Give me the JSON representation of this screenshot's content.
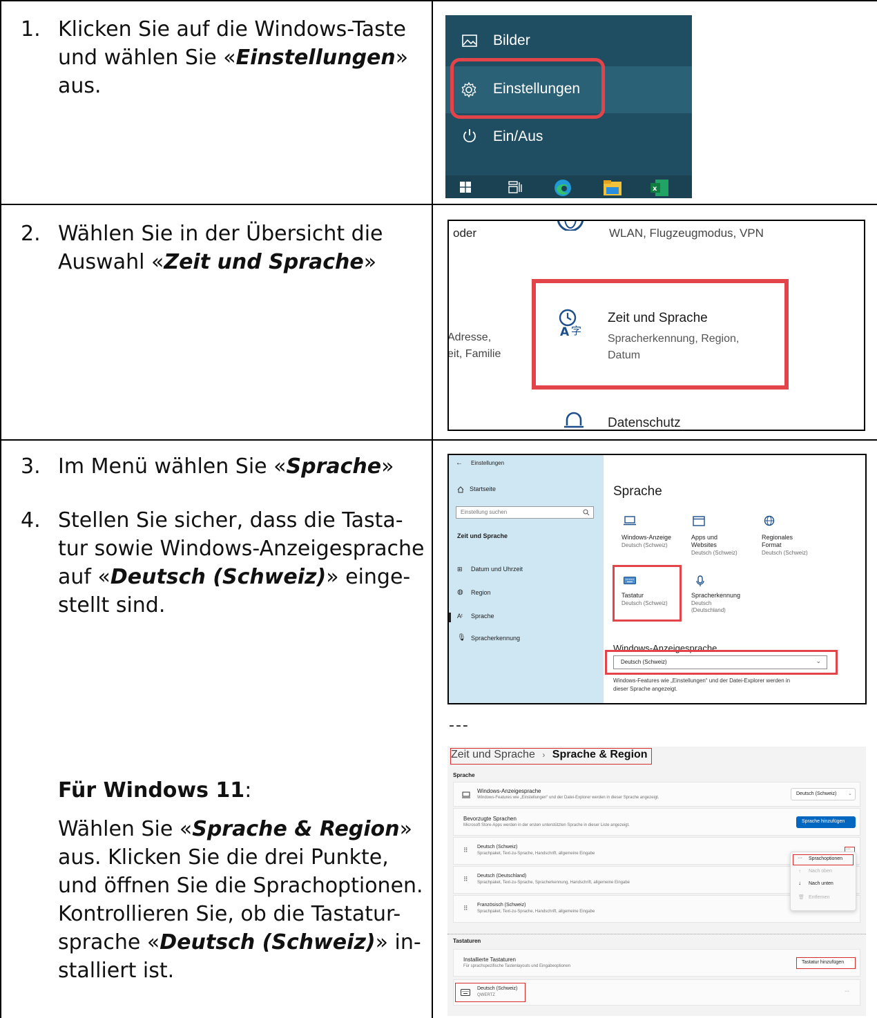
{
  "steps": {
    "s1": {
      "num": "1.",
      "l1": "Klicken Sie auf die Windows-Taste",
      "l2a": "und wählen Sie «",
      "l2b": "Einstellungen",
      "l2c": "»",
      "l3": "aus."
    },
    "s2": {
      "num": "2.",
      "l1": "Wählen Sie in der Übersicht die",
      "l2a": "Auswahl «",
      "l2b": "Zeit und Sprache",
      "l2c": "»"
    },
    "s3": {
      "num": "3.",
      "a": "Im Menü wählen Sie «",
      "b": "Sprache",
      "c": "»"
    },
    "s4": {
      "num": "4.",
      "l1": "Stellen Sie sicher, dass die Tasta-",
      "l2": "tur sowie Windows-Anzeigesprache",
      "l3a": "auf «",
      "l3b": "Deutsch (Schweiz)",
      "l3c": "» einge-",
      "l4": "stellt sind."
    },
    "w11": {
      "headA": "Für Windows 11",
      "headB": ":",
      "l1a": "Wählen Sie «",
      "l1b": "Sprache & Region",
      "l1c": "»",
      "l2": "aus. Klicken Sie die drei Punkte,",
      "l3": "und öffnen Sie die Sprachoptionen.",
      "l4": "Kontrollieren Sie, ob die Tastatur-",
      "l5a": "sprache «",
      "l5b": "Deutsch (Schweiz)",
      "l5c": "» in-",
      "l6": "stalliert ist."
    }
  },
  "shot1": {
    "items": [
      "Bilder",
      "Einstellungen",
      "Ein/Aus"
    ],
    "colors": {
      "bg": "#1f4e63",
      "highlight": "#2b6177",
      "red": "#e3444a"
    }
  },
  "shot2": {
    "top_left": "oder",
    "top_right": "WLAN, Flugzeugmodus, VPN",
    "tile_title": "Zeit und Sprache",
    "tile_sub1": "Spracherkennung, Region,",
    "tile_sub2": "Datum",
    "left1": "Adresse,",
    "left2": "eit, Familie",
    "bottom": "Datenschutz"
  },
  "shot3": {
    "back_label": "Einstellungen",
    "home": "Startseite",
    "search_placeholder": "Einstellung suchen",
    "section": "Zeit und Sprache",
    "nav": [
      "Datum und Uhrzeit",
      "Region",
      "Sprache",
      "Spracherkennung"
    ],
    "title": "Sprache",
    "tiles": [
      {
        "t": "Windows-Anzeige",
        "s": "Deutsch (Schweiz)"
      },
      {
        "t": "Apps und",
        "t2": "Websites",
        "s": "Deutsch (Schweiz)"
      },
      {
        "t": "Regionales",
        "t2": "Format",
        "s": "Deutsch (Schweiz)"
      },
      {
        "t": "Tastatur",
        "s": "Deutsch (Schweiz)"
      },
      {
        "t": "Spracherkennung",
        "s": "Deutsch",
        "s2": "(Deutschland)"
      }
    ],
    "display_lang_heading": "Windows-Anzeigesprache",
    "dropdown_value": "Deutsch (Schweiz)",
    "note1": "Windows-Features wie „Einstellungen“ und der Datei-Explorer werden in",
    "note2": "dieser Sprache angezeigt."
  },
  "separator": "---",
  "shot4": {
    "crumb1": "Zeit und Sprache",
    "crumb_sep": "›",
    "crumb2": "Sprache & Region",
    "section1": "Sprache",
    "rows": [
      {
        "t": "Windows-Anzeigesprache",
        "s": "Windows-Features wie „Einstellungen“ und der Datei-Explorer werden in dieser Sprache angezeigt."
      },
      {
        "t": "Bevorzugte Sprachen",
        "s": "Microsoft Store-Apps werden in der ersten unterstützten Sprache in dieser Liste angezeigt."
      },
      {
        "t": "Deutsch (Schweiz)",
        "s": "Sprachpaket, Text-zu-Sprache, Handschrift, allgemeine Eingabe"
      },
      {
        "t": "Deutsch (Deutschland)",
        "s": "Sprachpaket, Text-zu-Sprache, Spracherkennung, Handschrift, allgemeine Eingabe"
      },
      {
        "t": "Französisch (Schweiz)",
        "s": "Sprachpaket, Text-zu-Sprache, Handschrift, allgemeine Eingabe"
      }
    ],
    "display_select": "Deutsch (Schweiz)",
    "add_language": "Sprache hinzufügen",
    "more": "···",
    "context_menu": [
      "Sprachoptionen",
      "Nach oben",
      "Nach unten",
      "Entfernen"
    ],
    "section2": "Tastaturen",
    "installed_title": "Installierte Tastaturen",
    "installed_sub": "Für sprachspezifische Tastenlayouts und Eingabeoptionen",
    "add_keyboard": "Tastatur hinzufügen",
    "keyboard_name": "Deutsch (Schweiz)",
    "keyboard_layout": "QWERTZ",
    "accent": "#0067c0"
  }
}
